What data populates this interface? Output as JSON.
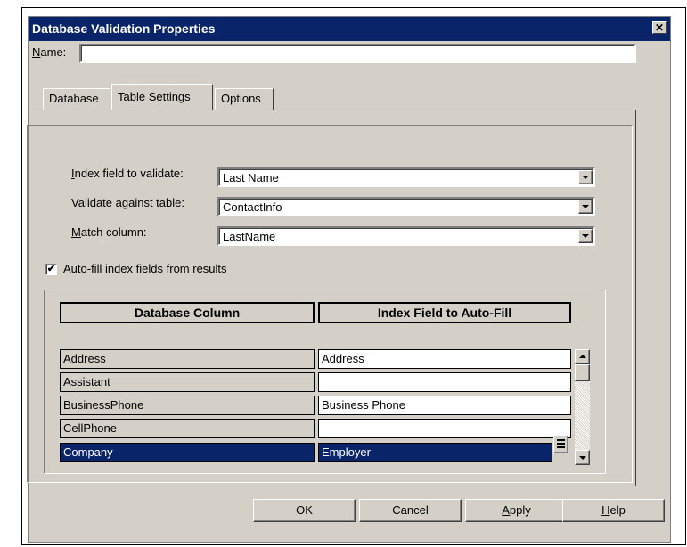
{
  "dialog": {
    "title": "Database Validation Properties",
    "close_glyph": "✕"
  },
  "name": {
    "label_mnemonic": "N",
    "label_rest": "ame:",
    "value": ""
  },
  "tabs": [
    {
      "label": "Database",
      "active": false
    },
    {
      "label": "Table Settings",
      "active": true
    },
    {
      "label": "Options",
      "active": false
    }
  ],
  "settings": {
    "index_field": {
      "label_mnemonic": "I",
      "label_rest": "ndex field to validate:",
      "value": "Last Name"
    },
    "validate_table": {
      "label_mnemonic": "V",
      "label_rest": "alidate against table:",
      "value": "ContactInfo"
    },
    "match_column": {
      "label_mnemonic": "M",
      "label_rest": "atch column:",
      "value": "LastName"
    }
  },
  "autofill": {
    "checked": true,
    "check_glyph": "✔",
    "label_before": "Auto-fill index ",
    "label_mnemonic": "f",
    "label_after": "ields from results"
  },
  "grid": {
    "headers": [
      "Database Column",
      "Index Field to Auto-Fill"
    ],
    "rows": [
      {
        "db_column": "Address",
        "index_field": "Address",
        "selected": false
      },
      {
        "db_column": "Assistant",
        "index_field": "",
        "selected": false
      },
      {
        "db_column": "BusinessPhone",
        "index_field": "Business Phone",
        "selected": false
      },
      {
        "db_column": "CellPhone",
        "index_field": "",
        "selected": false
      },
      {
        "db_column": "Company",
        "index_field": "Employer",
        "selected": true
      }
    ]
  },
  "buttons": {
    "ok": "OK",
    "cancel": "Cancel",
    "apply_mnemonic": "A",
    "apply_rest": "pply",
    "help_mnemonic": "H",
    "help_rest": "elp"
  },
  "colors": {
    "titlebar": "#0a246a",
    "face": "#d4d0c8",
    "selection": "#0a246a"
  }
}
